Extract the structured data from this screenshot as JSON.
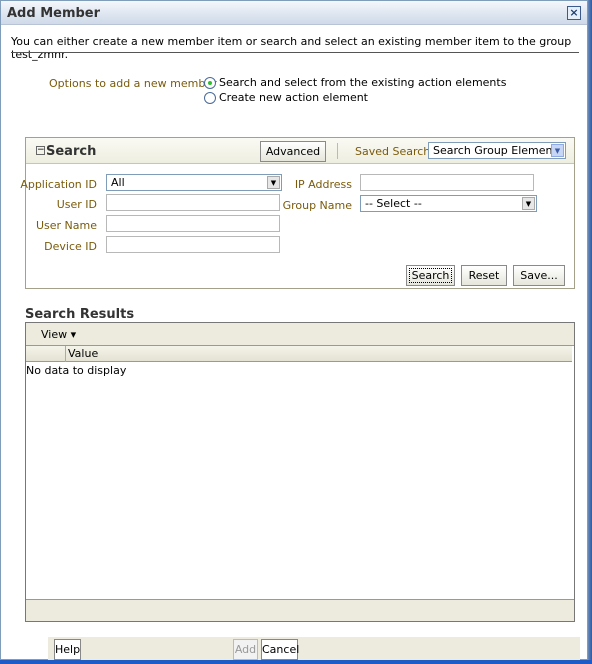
{
  "dialog": {
    "title": "Add Member",
    "close_icon": "×",
    "intro": "You can either create a new member item or search and select an existing member item to the group test_zmnr."
  },
  "options": {
    "label": "Options to add a new member",
    "choices": [
      {
        "label": "Search and select from the existing action elements",
        "selected": true
      },
      {
        "label": "Create new action element",
        "selected": false
      }
    ]
  },
  "search": {
    "title": "Search",
    "collapse_icon": "−",
    "advanced_label": "Advanced",
    "saved_search_label": "Saved Search",
    "saved_search_value": "Search Group Elements",
    "fields": {
      "application_id": {
        "label": "Application ID",
        "value": "All"
      },
      "user_id": {
        "label": "User ID",
        "value": ""
      },
      "user_name": {
        "label": "User Name",
        "value": ""
      },
      "device_id": {
        "label": "Device ID",
        "value": ""
      },
      "ip_address": {
        "label": "IP Address",
        "value": ""
      },
      "group_name": {
        "label": "Group Name",
        "value": "-- Select --"
      }
    },
    "buttons": {
      "search": "Search",
      "reset": "Reset",
      "save": "Save..."
    }
  },
  "results": {
    "title": "Search Results",
    "view_menu": "View ▾",
    "columns": [
      "",
      "Value"
    ],
    "empty_text": "No data to display"
  },
  "footer": {
    "help": "Help",
    "add": "Add",
    "cancel": "Cancel"
  }
}
